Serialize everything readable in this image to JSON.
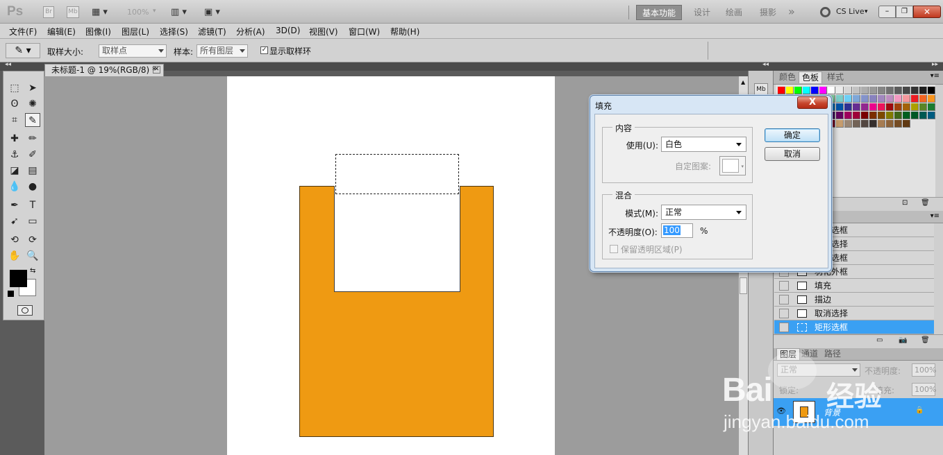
{
  "app": {
    "logo": "Ps",
    "bridge_label": "Br",
    "minibridge_label": "Mb",
    "zoom": "100%",
    "workspaces": [
      "基本功能",
      "设计",
      "绘画",
      "摄影"
    ],
    "overflow": "»",
    "cslive": "CS Live"
  },
  "menu": [
    "文件(F)",
    "编辑(E)",
    "图像(I)",
    "图层(L)",
    "选择(S)",
    "滤镜(T)",
    "分析(A)",
    "3D(D)",
    "视图(V)",
    "窗口(W)",
    "帮助(H)"
  ],
  "options": {
    "sample_size_label": "取样大小:",
    "sample_size_value": "取样点",
    "sample_label": "样本:",
    "sample_value": "所有图层",
    "show_ring_label": "显示取样环",
    "show_ring_checked": true
  },
  "document": {
    "tab_title": "未标题-1 @ 19%(RGB/8) *"
  },
  "colors": {
    "accent": "#3aa0f3",
    "fill_orange": "#ef9a12",
    "foreground": "#000000",
    "background": "#ffffff"
  },
  "panels": {
    "top_tabs": [
      "颜色",
      "色板",
      "样式"
    ],
    "active_top_tab": "色板",
    "history_items": [
      "矩形选框",
      "取消选择",
      "矩形选框",
      "羽化外框",
      "填充",
      "描边",
      "取消选择",
      "矩形选框"
    ],
    "layers_tabs": [
      "图层",
      "通道",
      "路径"
    ],
    "blend_mode": "正常",
    "opacity_label": "不透明度:",
    "opacity_value": "100%",
    "lock_label": "锁定:",
    "fill_label": "填充:",
    "fill_value": "100%",
    "layer_name": "背景"
  },
  "dialog": {
    "title": "填充",
    "close": "X",
    "content_group": "内容",
    "use_label": "使用(U):",
    "use_value": "白色",
    "custom_pattern_label": "自定图案:",
    "blend_group": "混合",
    "mode_label": "模式(M):",
    "mode_value": "正常",
    "opacity_label": "不透明度(O):",
    "opacity_value": "100",
    "opacity_unit": "%",
    "preserve_label": "保留透明区域(P)",
    "ok": "确定",
    "cancel": "取消"
  },
  "watermark": {
    "brand": "Bai",
    "brand_cn": "经验",
    "url": "jingyan.baidu.com"
  }
}
